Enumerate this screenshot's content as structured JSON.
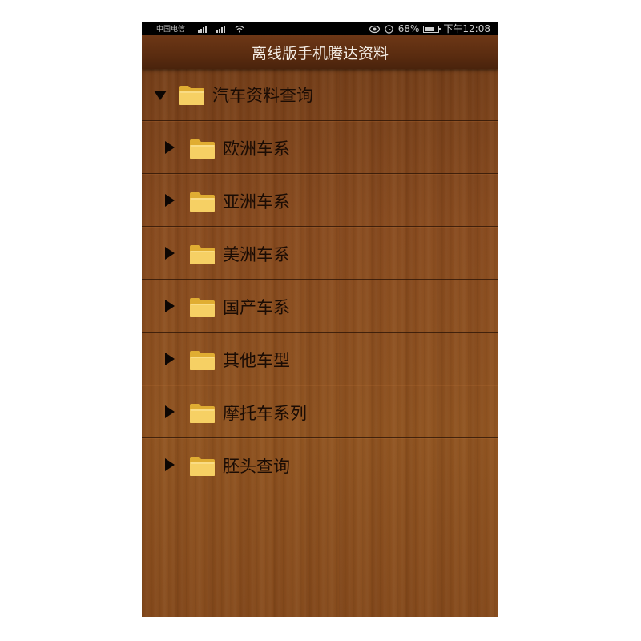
{
  "statusbar": {
    "carrier": "中国电信",
    "battery_percent": "68%",
    "time": "下午12:08",
    "icons": [
      "signal-icon",
      "signal-icon",
      "wifi-icon",
      "eye-icon",
      "alarm-icon",
      "battery-icon"
    ]
  },
  "header": {
    "title": "离线版手机腾达资料"
  },
  "tree": {
    "root": {
      "label": "汽车资料查询",
      "expanded": true
    },
    "children": [
      {
        "label": "欧洲车系"
      },
      {
        "label": "亚洲车系"
      },
      {
        "label": "美洲车系"
      },
      {
        "label": "国产车系"
      },
      {
        "label": "其他车型"
      },
      {
        "label": "摩托车系列"
      },
      {
        "label": "胚头查询"
      }
    ]
  },
  "colors": {
    "folder": "#f3c94e",
    "wood": "#874a1e",
    "titlebar": "#5a2c10"
  }
}
